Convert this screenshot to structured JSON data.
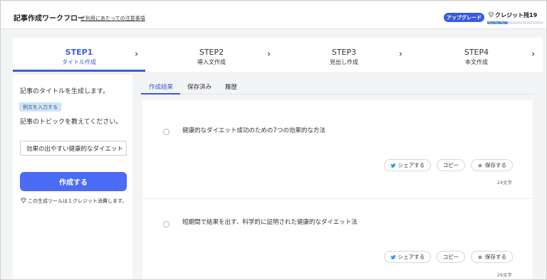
{
  "header": {
    "title": "記事作成ワークフロー",
    "notice_link": "ご利用にあたっての注意事項",
    "upgrade_label": "アップグレード",
    "credit_label": "クレジット残19",
    "credit_fraction": 0.37,
    "accent_color": "#3b5bdb"
  },
  "steps": [
    {
      "title": "STEP1",
      "subtitle": "タイトル作成",
      "active": true
    },
    {
      "title": "STEP2",
      "subtitle": "導入文作成",
      "active": false
    },
    {
      "title": "STEP3",
      "subtitle": "見出し作成",
      "active": false
    },
    {
      "title": "STEP4",
      "subtitle": "本文作成",
      "active": false
    }
  ],
  "left": {
    "description": "記事のタイトルを生成します。",
    "example_button": "例文を入力する",
    "topic_label": "記事のトピックを教えてください。",
    "topic_value": "効果の出やすい健康的なダイエット",
    "create_button": "作成する",
    "cost_note": "この生成ツールは１クレジット消費します。"
  },
  "tabs": [
    {
      "label": "作成結果",
      "active": true
    },
    {
      "label": "保存済み",
      "active": false
    },
    {
      "label": "履歴",
      "active": false
    }
  ],
  "results": [
    {
      "title": "健康的なダイエット成功のための7つの効果的な方法",
      "share": "シェアする",
      "copy": "コピー",
      "save": "保存する",
      "count": "24文字"
    },
    {
      "title": "短期間で結果を出す、科学的に証明された健康的なダイエット法",
      "share": "シェアする",
      "copy": "コピー",
      "save": "保存する",
      "count": "29文字"
    }
  ],
  "icons": {
    "diamond": "diamond-icon",
    "twitter": "twitter-bird-icon",
    "star": "star-icon",
    "chevron": "chevron-right-icon"
  }
}
